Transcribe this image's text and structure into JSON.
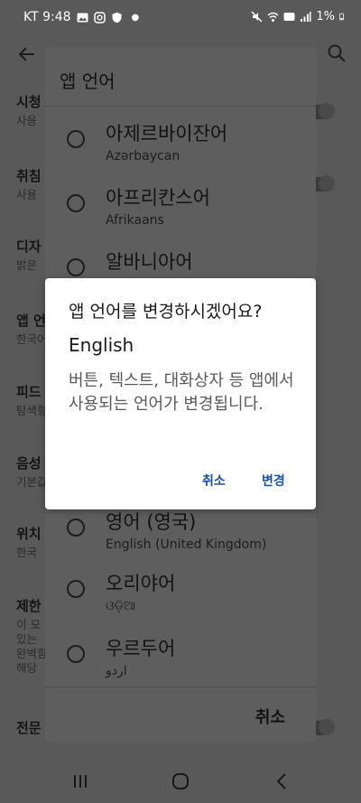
{
  "status_bar": {
    "carrier_time": "KT 9:48",
    "battery": "1%"
  },
  "settings_page": {
    "items": [
      {
        "title": "시청",
        "subtitle": "사용"
      },
      {
        "title": "취침",
        "subtitle": "사용"
      },
      {
        "title": "디자",
        "subtitle": "밝은"
      },
      {
        "title": "앱 언",
        "subtitle": "한국어"
      },
      {
        "title": "피드",
        "subtitle": "탐색형"
      },
      {
        "title": "음성",
        "subtitle": "기본값"
      },
      {
        "title": "위치",
        "subtitle": "한국"
      },
      {
        "title": "제한",
        "subtitle_lines": [
          "이 모",
          "있는",
          "완벽함",
          "해당"
        ]
      },
      {
        "title": "전문",
        "subtitle": ""
      }
    ]
  },
  "language_sheet": {
    "title": "앱 언어",
    "languages": [
      {
        "native": "아제르바이잔어",
        "sub": "Azərbaycan"
      },
      {
        "native": "아프리칸스어",
        "sub": "Afrikaans"
      },
      {
        "native": "알바니아어",
        "sub": ""
      },
      {
        "native": "영어 (영국)",
        "sub": "English (United Kingdom)"
      },
      {
        "native": "오리야어",
        "sub": "ଓଡ଼ିଆ"
      },
      {
        "native": "우르두어",
        "sub": "اردو"
      }
    ],
    "cancel_label": "취소"
  },
  "dialog": {
    "title": "앱 언어를 변경하시겠어요?",
    "language": "English",
    "message": "버튼, 텍스트, 대화상자 등 앱에서 사용되는 언어가 변경됩니다.",
    "cancel_label": "취소",
    "change_label": "변경"
  },
  "colors": {
    "accent": "#1a4fa8",
    "scrim": "#595959"
  }
}
